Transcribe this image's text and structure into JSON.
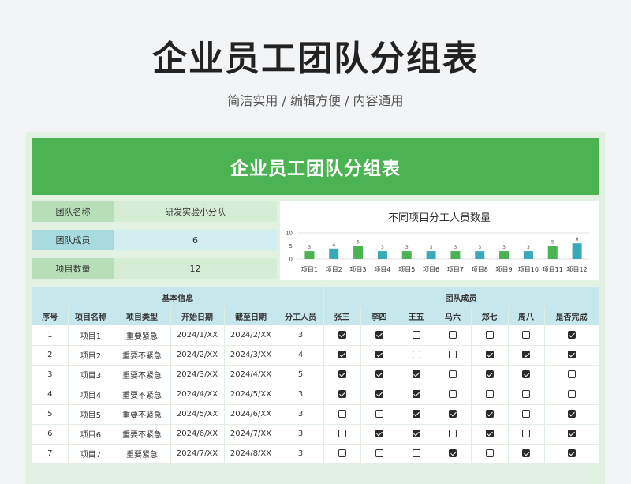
{
  "header": {
    "title": "企业员工团队分组表",
    "subtitle": "简洁实用 / 编辑方便 / 内容通用"
  },
  "sheet": {
    "banner": "企业员工团队分组表",
    "info": [
      {
        "label": "团队名称",
        "value": "研发实验小分队"
      },
      {
        "label": "团队成员",
        "value": "6"
      },
      {
        "label": "项目数量",
        "value": "12"
      }
    ]
  },
  "chart_data": {
    "type": "bar",
    "title": "不同项目分工人员数量",
    "categories": [
      "项目1",
      "项目2",
      "项目3",
      "项目4",
      "项目5",
      "项目6",
      "项目7",
      "项目8",
      "项目9",
      "项目10",
      "项目11",
      "项目12"
    ],
    "values": [
      3,
      4,
      5,
      3,
      3,
      3,
      3,
      3,
      3,
      3,
      5,
      6
    ],
    "colors": [
      "#4cb352",
      "#3aa9b7",
      "#4cb352",
      "#3aa9b7",
      "#4cb352",
      "#3aa9b7",
      "#4cb352",
      "#3aa9b7",
      "#4cb352",
      "#3aa9b7",
      "#4cb352",
      "#3aa9b7"
    ],
    "ylim": [
      0,
      10
    ],
    "yticks": [
      0,
      5,
      10
    ],
    "grid": true
  },
  "table": {
    "group_basic": "基本信息",
    "group_members": "团队成员",
    "columns": [
      "序号",
      "项目名称",
      "项目类型",
      "开始日期",
      "截至日期",
      "分工人员",
      "张三",
      "李四",
      "王五",
      "马六",
      "郑七",
      "周八",
      "是否完成"
    ],
    "rows": [
      {
        "no": "1",
        "name": "项目1",
        "type": "重要紧急",
        "start": "2024/1/XX",
        "end": "2024/2/XX",
        "count": "3",
        "checks": [
          true,
          true,
          false,
          false,
          false,
          false,
          true
        ]
      },
      {
        "no": "2",
        "name": "项目2",
        "type": "重要不紧急",
        "start": "2024/2/XX",
        "end": "2024/3/XX",
        "count": "4",
        "checks": [
          true,
          true,
          false,
          false,
          true,
          true,
          true
        ]
      },
      {
        "no": "3",
        "name": "项目3",
        "type": "重要不紧急",
        "start": "2024/3/XX",
        "end": "2024/4/XX",
        "count": "5",
        "checks": [
          true,
          true,
          true,
          false,
          true,
          true,
          false
        ]
      },
      {
        "no": "4",
        "name": "项目4",
        "type": "重要不紧急",
        "start": "2024/4/XX",
        "end": "2024/5/XX",
        "count": "3",
        "checks": [
          true,
          true,
          true,
          false,
          false,
          false,
          false
        ]
      },
      {
        "no": "5",
        "name": "项目5",
        "type": "重要不紧急",
        "start": "2024/5/XX",
        "end": "2024/6/XX",
        "count": "3",
        "checks": [
          false,
          false,
          true,
          true,
          true,
          false,
          true
        ]
      },
      {
        "no": "6",
        "name": "项目6",
        "type": "重要不紧急",
        "start": "2024/6/XX",
        "end": "2024/7/XX",
        "count": "3",
        "checks": [
          false,
          true,
          true,
          false,
          true,
          false,
          true
        ]
      },
      {
        "no": "7",
        "name": "项目7",
        "type": "重要紧急",
        "start": "2024/7/XX",
        "end": "2024/8/XX",
        "count": "3",
        "checks": [
          false,
          false,
          false,
          true,
          false,
          true,
          true
        ]
      }
    ]
  }
}
